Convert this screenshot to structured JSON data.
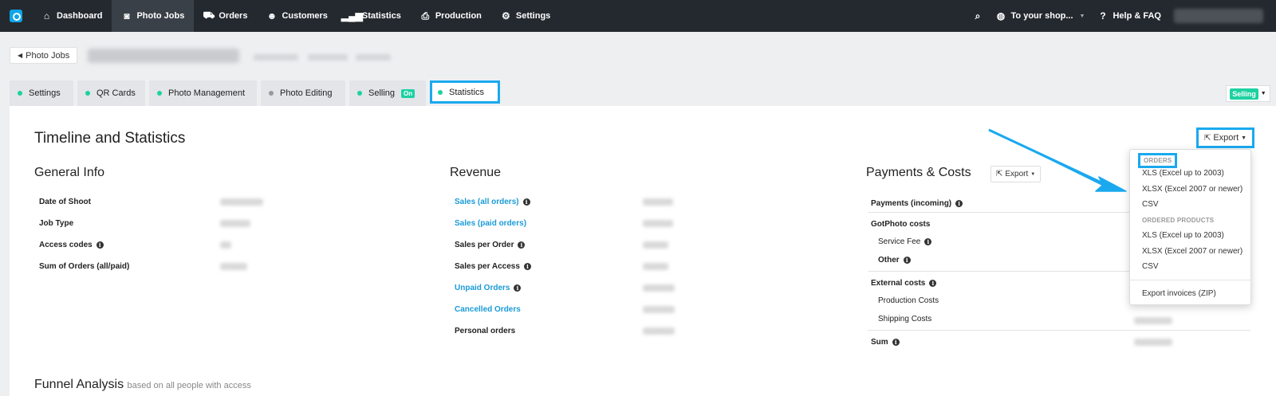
{
  "nav": {
    "items": [
      {
        "label": "Dashboard",
        "icon": "home-icon"
      },
      {
        "label": "Photo Jobs",
        "icon": "camera-icon"
      },
      {
        "label": "Orders",
        "icon": "cart-icon"
      },
      {
        "label": "Customers",
        "icon": "user-icon"
      },
      {
        "label": "Statistics",
        "icon": "bar-chart-icon"
      },
      {
        "label": "Production",
        "icon": "printer-icon"
      },
      {
        "label": "Settings",
        "icon": "gear-icon"
      }
    ],
    "shop_link": "To your shop...",
    "help": "Help & FAQ"
  },
  "header": {
    "back_label": "Photo Jobs"
  },
  "tabs": [
    {
      "label": "Settings",
      "status": "green"
    },
    {
      "label": "QR Cards",
      "status": "green"
    },
    {
      "label": "Photo Management",
      "status": "green"
    },
    {
      "label": "Photo Editing",
      "status": "gray"
    },
    {
      "label": "Selling",
      "status": "green",
      "badge": "On"
    },
    {
      "label": "Statistics",
      "status": "green"
    }
  ],
  "selling_status": "Selling",
  "main": {
    "title": "Timeline and Statistics",
    "export_label": "Export",
    "general_info": {
      "title": "General Info",
      "rows": [
        "Date of Shoot",
        "Job Type",
        "Access codes",
        "Sum of Orders (all/paid)"
      ]
    },
    "revenue": {
      "title": "Revenue",
      "rows": [
        "Sales (all orders)",
        "Sales (paid orders)",
        "Sales per Order",
        "Sales per Access",
        "Unpaid Orders",
        "Cancelled Orders",
        "Personal orders"
      ]
    },
    "payments": {
      "title": "Payments & Costs",
      "export_label": "Export",
      "rows": [
        "Payments (incoming)",
        "GotPhoto costs",
        "Service Fee",
        "Other",
        "External costs",
        "Production Costs",
        "Shipping Costs",
        "Sum"
      ]
    },
    "funnel_title": "Funnel Analysis",
    "funnel_sub": "based on all people with access"
  },
  "export_menu": {
    "orders_header": "ORDERS",
    "orders_items": [
      "XLS (Excel up to 2003)",
      "XLSX (Excel 2007 or newer)",
      "CSV"
    ],
    "products_header": "ORDERED PRODUCTS",
    "products_items": [
      "XLS (Excel up to 2003)",
      "XLSX (Excel 2007 or newer)",
      "CSV"
    ],
    "invoices": "Export invoices (ZIP)"
  },
  "colors": {
    "accent": "#1aa9ef",
    "nav_bg": "#24292f",
    "green": "#1dd1a1",
    "link": "#1a9bd7"
  }
}
